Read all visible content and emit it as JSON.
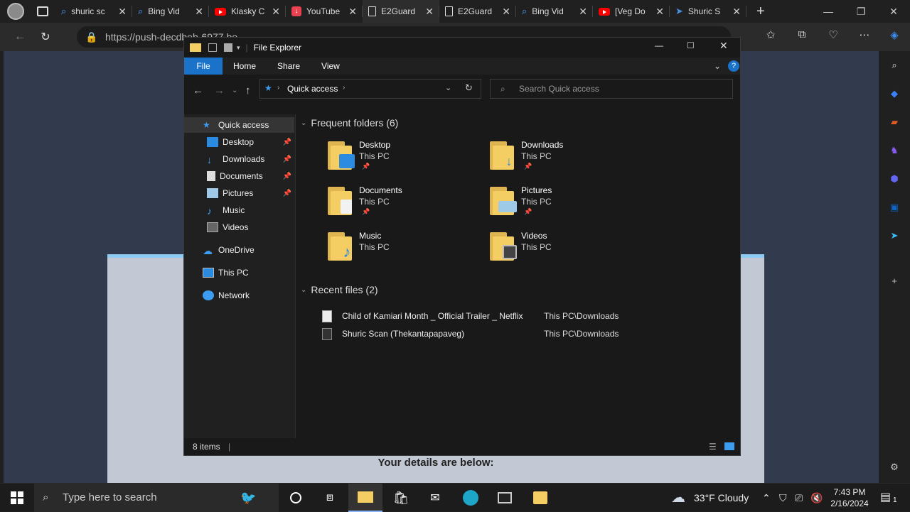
{
  "browser": {
    "tabs": [
      {
        "label": "shuric sc",
        "icon": "search-icon"
      },
      {
        "label": "Bing Vid",
        "icon": "search-icon"
      },
      {
        "label": "Klasky C",
        "icon": "youtube-icon"
      },
      {
        "label": "YouTube",
        "icon": "download-icon"
      },
      {
        "label": "E2Guard",
        "icon": "document-icon"
      },
      {
        "label": "E2Guard",
        "icon": "document-icon"
      },
      {
        "label": "Bing Vid",
        "icon": "search-icon"
      },
      {
        "label": "[Veg Do",
        "icon": "youtube-icon"
      },
      {
        "label": "Shuric S",
        "icon": "wing-icon"
      }
    ],
    "url": "https://push-decdbeb-6977.bo"
  },
  "page": {
    "details_text": "Your details are below:"
  },
  "explorer": {
    "title": "File Explorer",
    "ribbon_tabs": [
      "File",
      "Home",
      "Share",
      "View"
    ],
    "address": "Quick access",
    "search_placeholder": "Search Quick access",
    "nav": {
      "quick_access": "Quick access",
      "desktop": "Desktop",
      "downloads": "Downloads",
      "documents": "Documents",
      "pictures": "Pictures",
      "music": "Music",
      "videos": "Videos",
      "onedrive": "OneDrive",
      "this_pc": "This PC",
      "network": "Network"
    },
    "frequent_header": "Frequent folders (6)",
    "folders": [
      {
        "name": "Desktop",
        "location": "This PC",
        "pinned": true
      },
      {
        "name": "Downloads",
        "location": "This PC",
        "pinned": true
      },
      {
        "name": "Documents",
        "location": "This PC",
        "pinned": true
      },
      {
        "name": "Pictures",
        "location": "This PC",
        "pinned": true
      },
      {
        "name": "Music",
        "location": "This PC",
        "pinned": false
      },
      {
        "name": "Videos",
        "location": "This PC",
        "pinned": false
      }
    ],
    "recent_header": "Recent files (2)",
    "recent": [
      {
        "name": "Child of Kamiari Month _ Official Trailer _ Netflix",
        "location": "This PC\\Downloads"
      },
      {
        "name": "Shuric Scan (Thekantapapaveg)",
        "location": "This PC\\Downloads"
      }
    ],
    "status": "8 items"
  },
  "taskbar": {
    "search_placeholder": "Type here to search",
    "weather": "33°F  Cloudy",
    "time": "7:43 PM",
    "date": "2/16/2024",
    "notification_count": "1"
  }
}
